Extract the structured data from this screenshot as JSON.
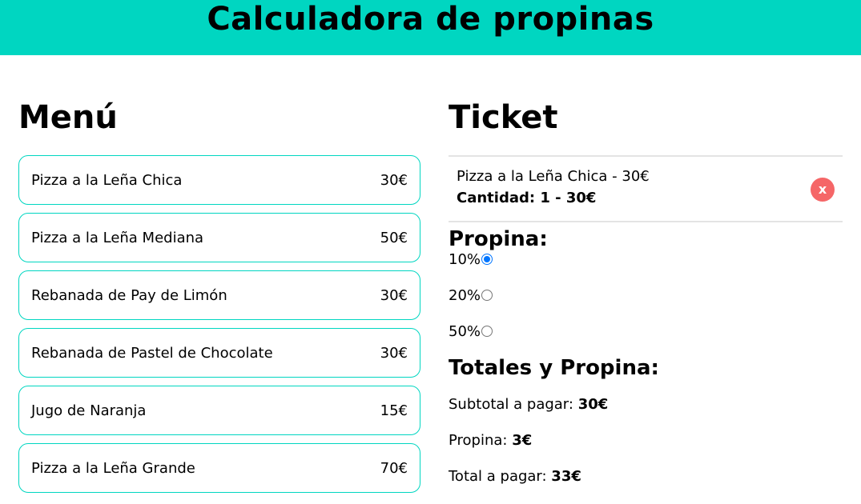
{
  "header": {
    "title": "Calculadora de propinas"
  },
  "menu": {
    "title": "Menú",
    "items": [
      {
        "name": "Pizza a la Leña Chica",
        "price": "30€"
      },
      {
        "name": "Pizza a la Leña Mediana",
        "price": "50€"
      },
      {
        "name": "Rebanada de Pay de Limón",
        "price": "30€"
      },
      {
        "name": "Rebanada de Pastel de Chocolate",
        "price": "30€"
      },
      {
        "name": "Jugo de Naranja",
        "price": "15€"
      },
      {
        "name": "Pizza a la Leña Grande",
        "price": "70€"
      }
    ]
  },
  "ticket": {
    "title": "Ticket",
    "order": {
      "line1": "Pizza a la Leña Chica - 30€",
      "line2": "Cantidad: 1 - 30€",
      "remove_label": "x"
    },
    "tip": {
      "title": "Propina:",
      "options": [
        {
          "label": "10%",
          "checked": true
        },
        {
          "label": "20%",
          "checked": false
        },
        {
          "label": "50%",
          "checked": false
        }
      ]
    },
    "totals": {
      "title": "Totales y Propina:",
      "subtotal_label": "Subtotal a pagar: ",
      "subtotal_value": "30€",
      "tip_label": "Propina: ",
      "tip_value": "3€",
      "total_label": "Total a pagar: ",
      "total_value": "33€"
    }
  },
  "colors": {
    "accent": "#00d6c1",
    "remove": "#f56667",
    "radio": "#0075ff"
  }
}
